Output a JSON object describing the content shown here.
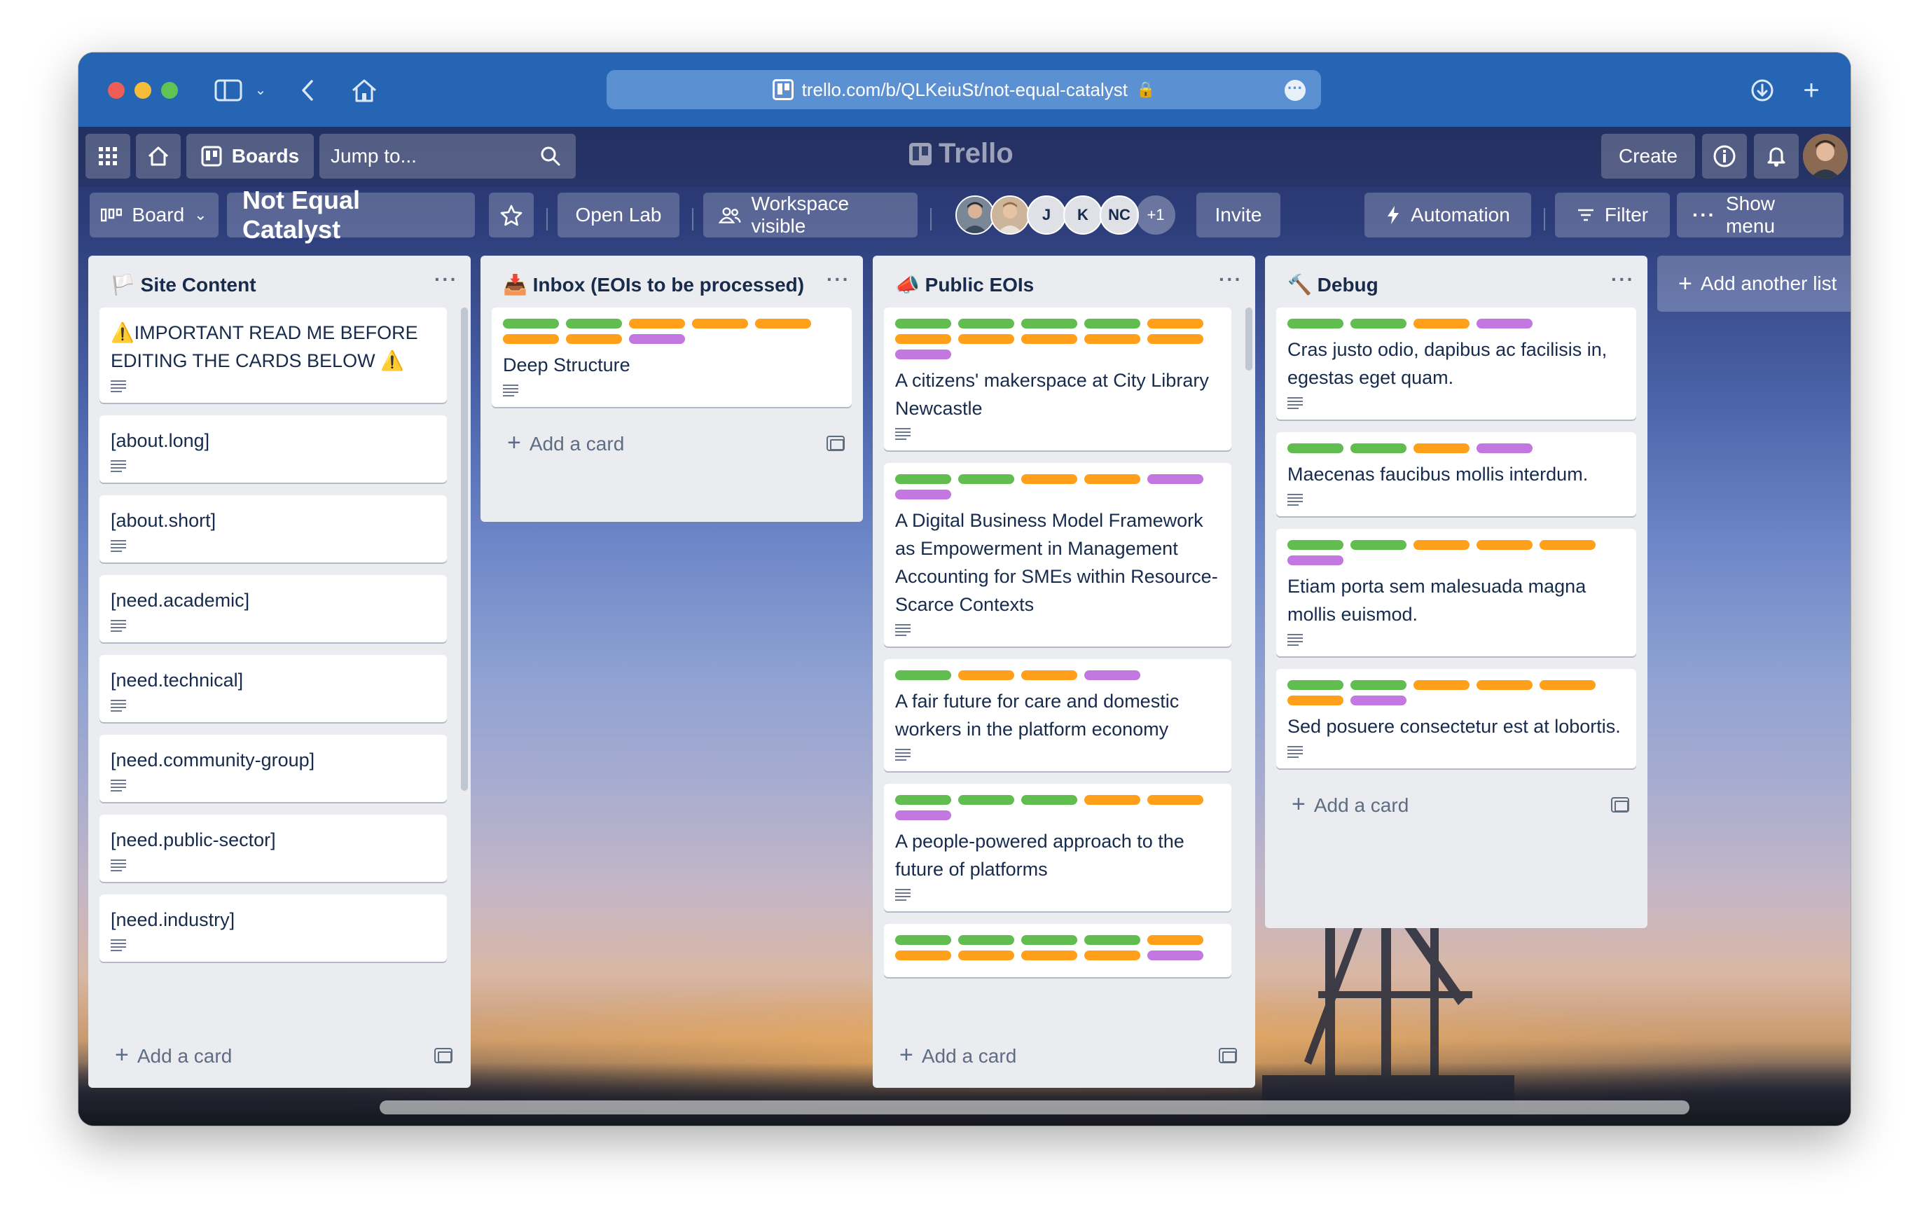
{
  "browser": {
    "url": "trello.com/b/QLKeiuSt/not-equal-catalyst",
    "traffic_colors": [
      "#ee5e57",
      "#f6bd3a",
      "#5fc454"
    ]
  },
  "header": {
    "boards_label": "Boards",
    "jump_placeholder": "Jump to...",
    "logo_text": "Trello",
    "create_label": "Create"
  },
  "board": {
    "view_label": "Board",
    "title": "Not Equal Catalyst",
    "workspace_label": "Open Lab",
    "visibility_label": "Workspace visible",
    "members": [
      "J",
      "K",
      "NC"
    ],
    "members_more": "+1",
    "invite_label": "Invite",
    "automation_label": "Automation",
    "filter_label": "Filter",
    "show_menu_label": "Show menu"
  },
  "lists": [
    {
      "icon": "flag-icon",
      "title": "Site Content",
      "cards": [
        {
          "title": "⚠️IMPORTANT READ ME BEFORE EDITING THE CARDS BELOW ⚠️",
          "labels": []
        },
        {
          "title": "[about.long]",
          "labels": []
        },
        {
          "title": "[about.short]",
          "labels": []
        },
        {
          "title": "[need.academic]",
          "labels": []
        },
        {
          "title": "[need.technical]",
          "labels": []
        },
        {
          "title": "[need.community-group]",
          "labels": []
        },
        {
          "title": "[need.public-sector]",
          "labels": []
        },
        {
          "title": "[need.industry]",
          "labels": []
        }
      ],
      "add_card": "Add a card"
    },
    {
      "icon": "inbox-tray-icon",
      "title": "Inbox (EOIs to be processed)",
      "cards": [
        {
          "title": "Deep Structure",
          "labels": [
            "green",
            "green",
            "orange",
            "orange",
            "orange",
            "orange",
            "orange",
            "purple"
          ]
        }
      ],
      "add_card": "Add a card"
    },
    {
      "icon": "megaphone-icon",
      "title": "Public EOIs",
      "cards": [
        {
          "title": "A citizens' makerspace at City Library Newcastle",
          "labels": [
            "green",
            "green",
            "green",
            "green",
            "orange",
            "orange",
            "orange",
            "orange",
            "orange",
            "orange",
            "purple"
          ]
        },
        {
          "title": "A Digital Business Model Framework as Empowerment in Management Accounting for SMEs within Resource-Scarce Contexts",
          "labels": [
            "green",
            "green",
            "orange",
            "orange",
            "purple",
            "purple"
          ]
        },
        {
          "title": "A fair future for care and domestic workers in the platform economy",
          "labels": [
            "green",
            "orange",
            "orange",
            "purple"
          ]
        },
        {
          "title": "A people-powered approach to the future of platforms",
          "labels": [
            "green",
            "green",
            "green",
            "orange",
            "orange",
            "purple"
          ]
        },
        {
          "title": "",
          "labels": [
            "green",
            "green",
            "green",
            "green",
            "orange",
            "orange",
            "orange",
            "orange",
            "orange",
            "purple"
          ]
        }
      ],
      "add_card": "Add a card"
    },
    {
      "icon": "hammer-icon",
      "title": "Debug",
      "cards": [
        {
          "title": "Cras justo odio, dapibus ac facilisis in, egestas eget quam.",
          "labels": [
            "green",
            "green",
            "orange",
            "purple"
          ]
        },
        {
          "title": "Maecenas faucibus mollis interdum.",
          "labels": [
            "green",
            "green",
            "orange",
            "purple"
          ]
        },
        {
          "title": "Etiam porta sem malesuada magna mollis euismod.",
          "labels": [
            "green",
            "green",
            "orange",
            "orange",
            "orange",
            "purple"
          ]
        },
        {
          "title": "Sed posuere consectetur est at lobortis.",
          "labels": [
            "green",
            "green",
            "orange",
            "orange",
            "orange",
            "orange",
            "purple"
          ]
        }
      ],
      "add_card": "Add a card"
    }
  ],
  "add_list_label": "Add another list"
}
